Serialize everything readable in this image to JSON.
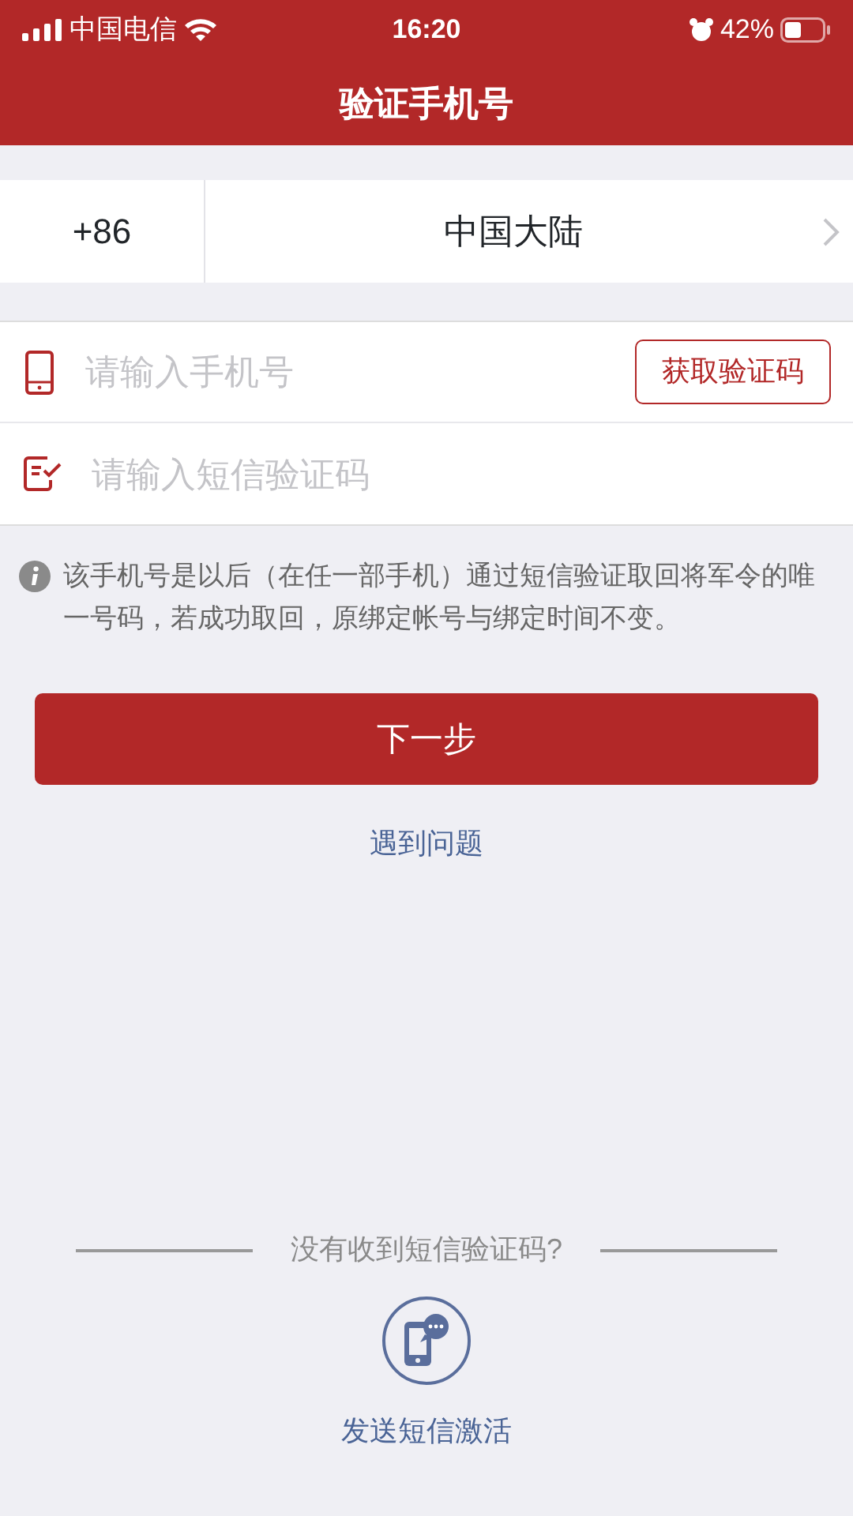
{
  "status_bar": {
    "carrier": "中国电信",
    "time": "16:20",
    "battery": "42%"
  },
  "nav": {
    "title": "验证手机号"
  },
  "country": {
    "code": "+86",
    "name": "中国大陆"
  },
  "phone_field": {
    "placeholder": "请输入手机号"
  },
  "get_code_button": "获取验证码",
  "code_field": {
    "placeholder": "请输入短信验证码"
  },
  "notice": "该手机号是以后（在任一部手机）通过短信验证取回将军令的唯一号码，若成功取回，原绑定帐号与绑定时间不变。",
  "next_button": "下一步",
  "help_link": "遇到问题",
  "divider_text": "没有收到短信验证码?",
  "sms_activate": "发送短信激活"
}
